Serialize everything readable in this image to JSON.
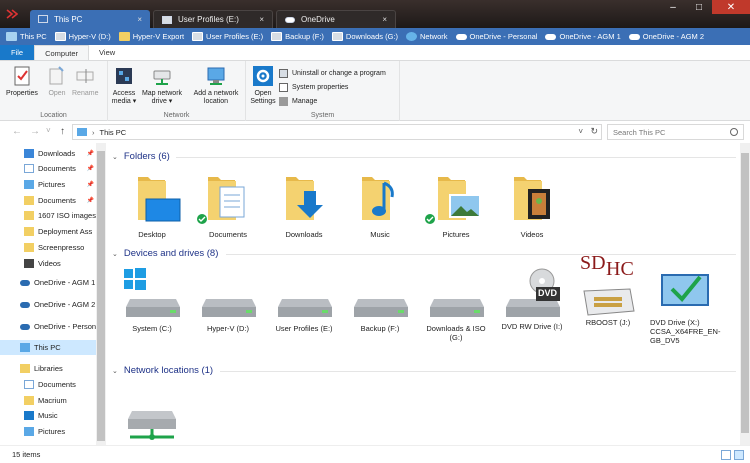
{
  "tabs": [
    {
      "label": "This PC",
      "close": "×",
      "active": true
    },
    {
      "label": "User Profiles (E:)",
      "close": "×",
      "active": false
    },
    {
      "label": "OneDrive",
      "close": "×",
      "active": false
    }
  ],
  "window_controls": {
    "minimize": "–",
    "maximize": "□",
    "close": "✕"
  },
  "quick_access": [
    {
      "label": "This PC",
      "icon": "pc-icon"
    },
    {
      "label": "Hyper-V (D:)",
      "icon": "drive-icon"
    },
    {
      "label": "Hyper-V Export",
      "icon": "folder-icon"
    },
    {
      "label": "User Profiles (E:)",
      "icon": "drive-icon"
    },
    {
      "label": "Backup (F:)",
      "icon": "drive-icon"
    },
    {
      "label": "Downloads (G:)",
      "icon": "drive-icon"
    },
    {
      "label": "Network",
      "icon": "network-icon"
    },
    {
      "label": "OneDrive - Personal",
      "icon": "cloud-icon"
    },
    {
      "label": "OneDrive - AGM 1",
      "icon": "cloud-icon"
    },
    {
      "label": "OneDrive - AGM 2",
      "icon": "cloud-icon"
    }
  ],
  "ribbon_tabs": {
    "file": "File",
    "computer": "Computer",
    "view": "View"
  },
  "ribbon": {
    "location": {
      "label": "Location",
      "properties": "Properties",
      "open": "Open",
      "rename": "Rename"
    },
    "network": {
      "label": "Network",
      "access_media_1": "Access",
      "access_media_2": "media ▾",
      "map_drive_1": "Map network",
      "map_drive_2": "drive ▾",
      "add_location_1": "Add a network",
      "add_location_2": "location"
    },
    "system": {
      "label": "System",
      "open_settings_1": "Open",
      "open_settings_2": "Settings",
      "uninstall": "Uninstall or change a program",
      "system_properties": "System properties",
      "manage": "Manage"
    }
  },
  "address": {
    "back": "←",
    "forward": "→",
    "recent": "˅",
    "up": "↑",
    "separator": "›",
    "path": "This PC",
    "dropdown": "˅",
    "refresh": "↻",
    "search_placeholder": "Search This PC"
  },
  "nav": {
    "items": [
      {
        "label": "Downloads",
        "pinned": true
      },
      {
        "label": "Documents",
        "pinned": true
      },
      {
        "label": "Pictures",
        "pinned": true
      },
      {
        "label": "Documents",
        "pinned": true
      },
      {
        "label": "1607 ISO images",
        "pinned": false
      },
      {
        "label": "Deployment Ass",
        "pinned": false
      },
      {
        "label": "Screenpresso",
        "pinned": false
      },
      {
        "label": "Videos",
        "pinned": false
      },
      {
        "label": "OneDrive - AGM 1",
        "pinned": false
      },
      {
        "label": "OneDrive - AGM 2",
        "pinned": false
      },
      {
        "label": "OneDrive - Personal",
        "pinned": false
      },
      {
        "label": "This PC",
        "pinned": false
      },
      {
        "label": "Libraries",
        "pinned": false
      },
      {
        "label": "Documents",
        "pinned": false
      },
      {
        "label": "Macrium",
        "pinned": false
      },
      {
        "label": "Music",
        "pinned": false
      },
      {
        "label": "Pictures",
        "pinned": false
      }
    ],
    "pin_glyph": "📌"
  },
  "sections": {
    "folders": "Folders (6)",
    "devices": "Devices and drives (8)",
    "network": "Network locations (1)",
    "chevron": "⌄"
  },
  "folders": [
    {
      "label": "Desktop"
    },
    {
      "label": "Documents"
    },
    {
      "label": "Downloads"
    },
    {
      "label": "Music"
    },
    {
      "label": "Pictures"
    },
    {
      "label": "Videos"
    }
  ],
  "drives": [
    {
      "label": "System (C:)"
    },
    {
      "label": "Hyper-V (D:)"
    },
    {
      "label": "User Profiles (E:)"
    },
    {
      "label": "Backup (F:)"
    },
    {
      "label": "Downloads & ISO (G:)"
    },
    {
      "label": "DVD RW Drive (I:)",
      "badge": "DVD"
    },
    {
      "label": "RBOOST (J:)",
      "badge_1": "SD",
      "badge_2": "HC"
    },
    {
      "label": "DVD Drive (X:) CCSA_X64FRE_EN-GB_DV5"
    }
  ],
  "status": {
    "items": "15 items"
  },
  "colors": {
    "accent": "#3b6fb5",
    "file_tab": "#1979ca",
    "section_head": "#1e3287",
    "folder_yellow": "#f2cf63",
    "selected": "#cde8ff",
    "sync_green": "#1ea34a"
  }
}
